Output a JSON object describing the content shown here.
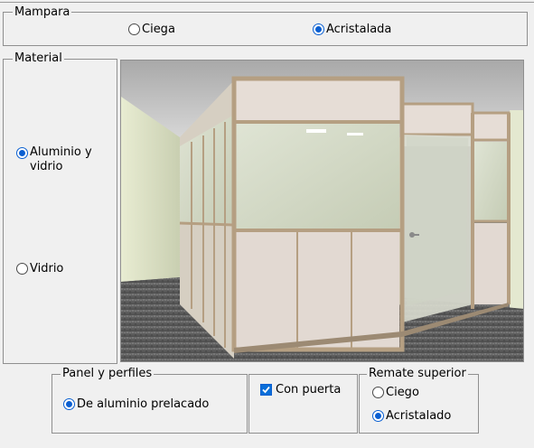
{
  "mampara": {
    "legend": "Mampara",
    "options": [
      {
        "label": "Ciega",
        "selected": false
      },
      {
        "label": "Acristalada",
        "selected": true
      }
    ]
  },
  "material": {
    "legend": "Material",
    "options": [
      {
        "label_line1": "Aluminio y",
        "label_line2": "vidrio",
        "selected": true
      },
      {
        "label_line1": "Vidrio",
        "label_line2": "",
        "selected": false
      }
    ]
  },
  "preview": {
    "icon": "office-partition-render"
  },
  "panel_perfiles": {
    "legend": "Panel y perfiles",
    "option": {
      "label": "De aluminio prelacado",
      "selected": true
    }
  },
  "puerta": {
    "label": "Con puerta",
    "checked": true
  },
  "remate": {
    "legend": "Remate superior",
    "options": [
      {
        "label": "Ciego",
        "selected": false
      },
      {
        "label": "Acristalado",
        "selected": true
      }
    ]
  },
  "colors": {
    "accent": "#0a5fd1",
    "background": "#f0f0f0",
    "frame_border": "#8f8f8f"
  }
}
